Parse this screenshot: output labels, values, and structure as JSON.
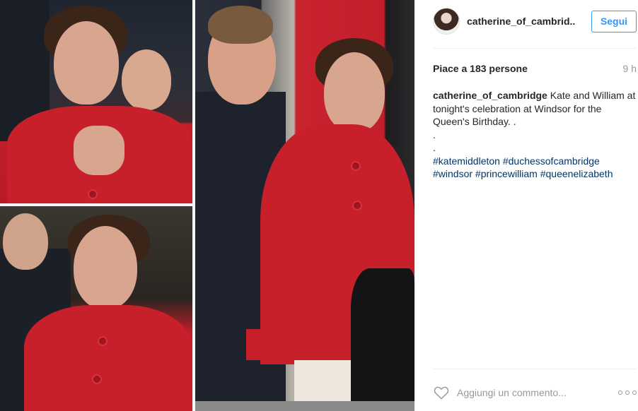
{
  "post": {
    "username": "catherine_of_cambrid..",
    "follow_label": "Segui",
    "likes": "Piace a 183 persone",
    "time": "9 h",
    "caption": {
      "username": "catherine_of_cambridge",
      "text": "Kate and William at tonight's celebration at Windsor for the Queen's Birthday. .",
      "dots": [
        ".",
        "."
      ],
      "tags_line1": "#katemiddleton #duchessofcambridge",
      "tags_line2": "#windsor #princewilliam #queenelizabeth"
    },
    "comment_placeholder": "Aggiungi un commento...",
    "icons": {
      "like": "heart-icon",
      "more": "more-options-icon"
    },
    "colors": {
      "link": "#3897f0",
      "hashtag": "#003569",
      "muted": "#999999"
    }
  }
}
